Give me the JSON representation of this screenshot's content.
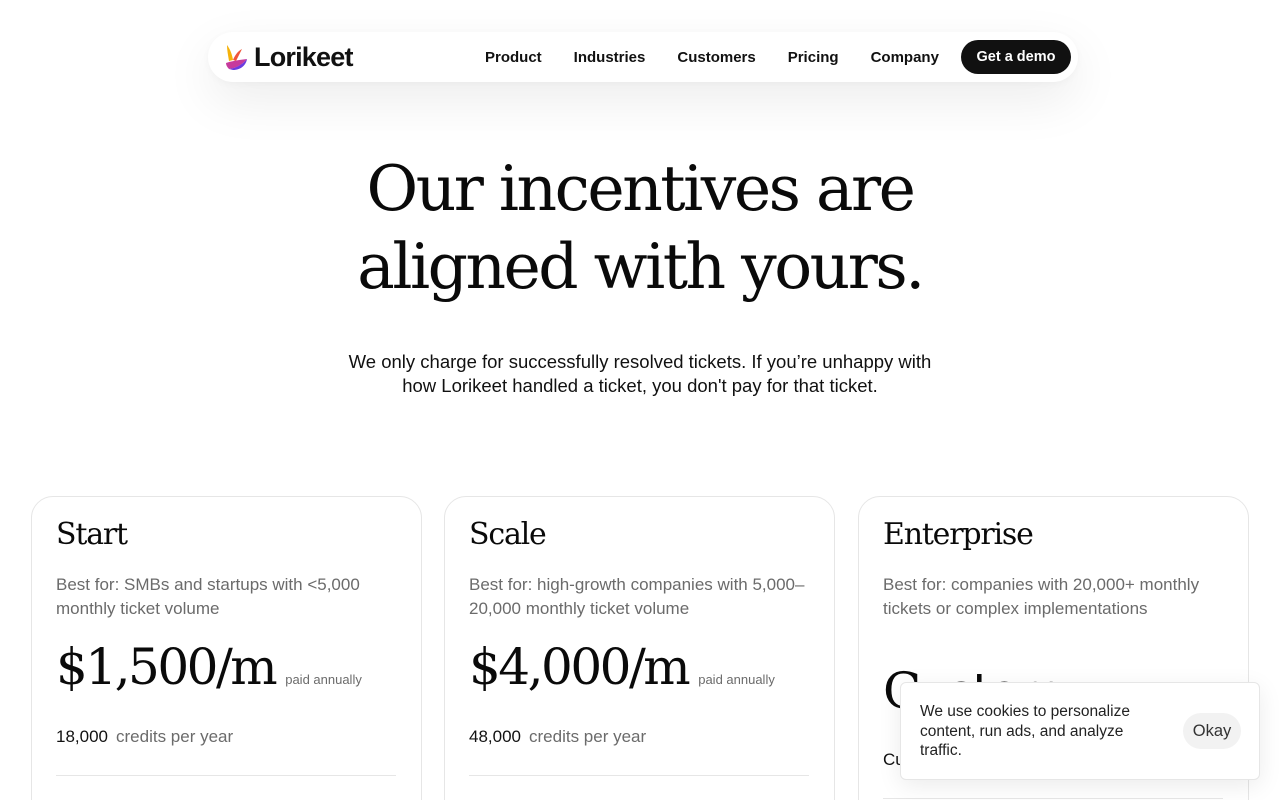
{
  "nav": {
    "brand": "Lorikeet",
    "links": [
      "Product",
      "Industries",
      "Customers",
      "Pricing",
      "Company"
    ],
    "cta": "Get a demo"
  },
  "hero": {
    "title_line1": "Our incentives are",
    "title_line2": "aligned with yours.",
    "subtitle": "We only charge for successfully resolved tickets. If you’re unhappy with how Lorikeet handled a ticket, you don't pay for that ticket."
  },
  "plans": [
    {
      "name": "Start",
      "description": "Best for: SMBs and startups with <5,000 monthly ticket volume",
      "price": "$1,500/m",
      "price_note": "paid annually",
      "credits": "18,000",
      "credits_label": "credits per year"
    },
    {
      "name": "Scale",
      "description": "Best for: high-growth companies with 5,000–20,000 monthly ticket volume",
      "price": "$4,000/m",
      "price_note": "paid annually",
      "credits": "48,000",
      "credits_label": "credits per year"
    },
    {
      "name": "Enterprise",
      "description": "Best for: companies with 20,000+ monthly tickets or complex implementations",
      "price": "Custom",
      "price_note": "",
      "credits": "Cu",
      "credits_label": ""
    }
  ],
  "cookie": {
    "text": "We use cookies to personalize content, run ads, and analyze traffic.",
    "button": "Okay"
  },
  "colors": {
    "brand_gradient": [
      "#f5b20a",
      "#f0563a",
      "#c63a9c",
      "#6a3be0"
    ],
    "cta_background": "#111111"
  }
}
